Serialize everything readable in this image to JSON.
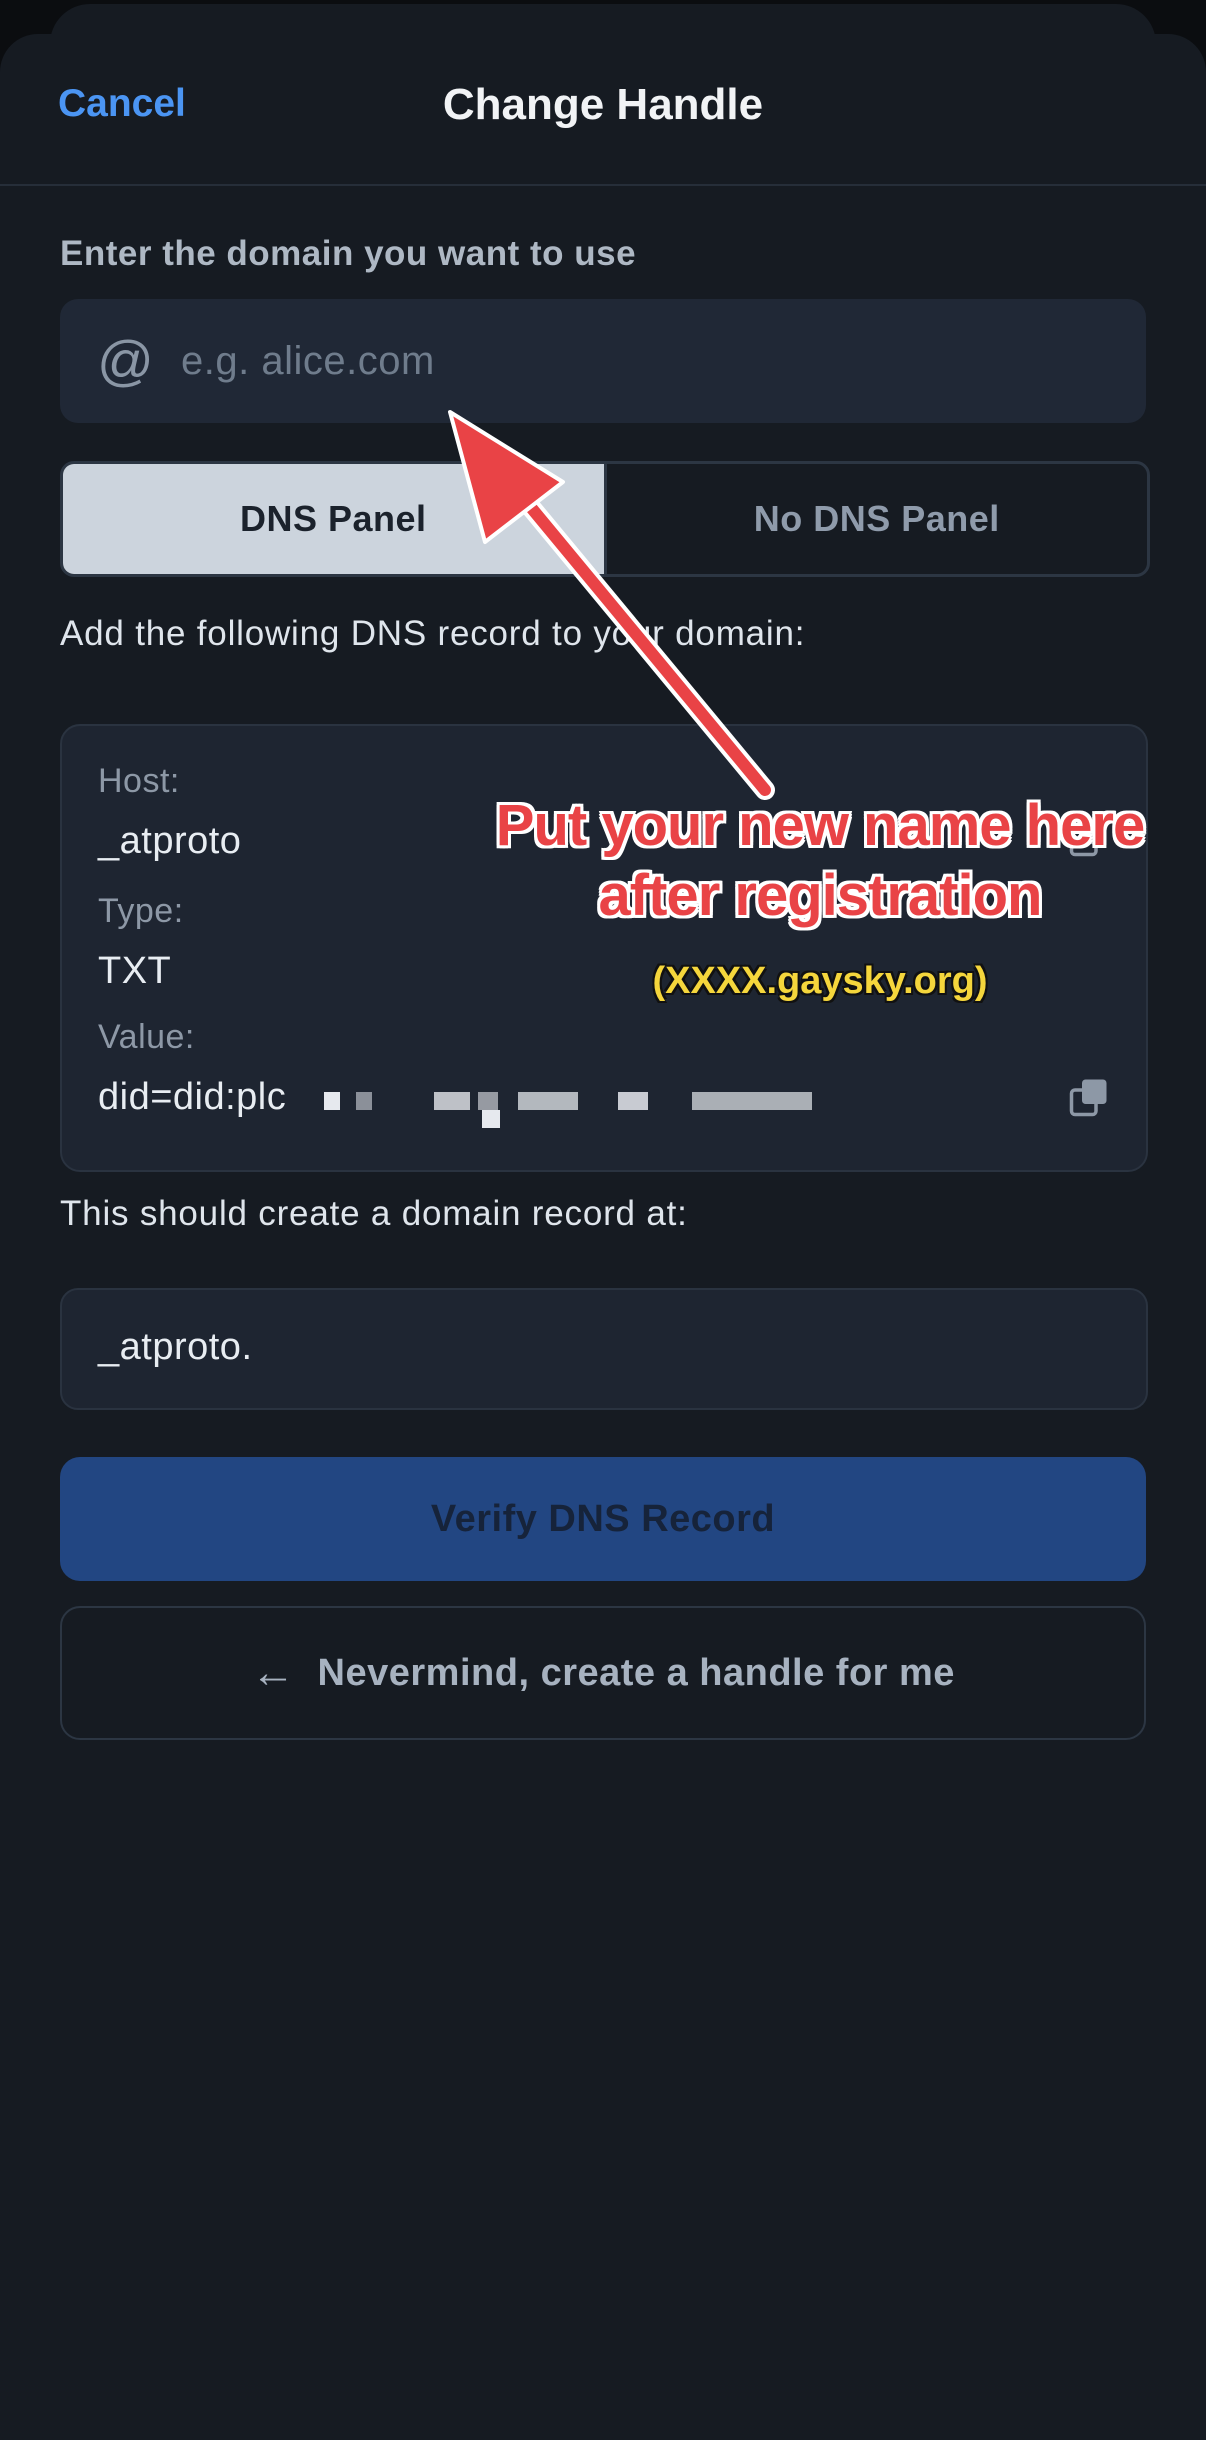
{
  "header": {
    "cancel_label": "Cancel",
    "title": "Change Handle"
  },
  "domain_section": {
    "label": "Enter the domain you want to use",
    "at_symbol": "@",
    "placeholder": "e.g. alice.com",
    "value": ""
  },
  "segmented": {
    "options": [
      "DNS Panel",
      "No DNS Panel"
    ],
    "selected": "DNS Panel"
  },
  "instructions": "Add the following DNS record to your domain:",
  "record": {
    "host_label": "Host:",
    "host_value": "_atproto",
    "type_label": "Type:",
    "type_value": "TXT",
    "value_label": "Value:",
    "value_prefix": "did=did:plc"
  },
  "domain_record": {
    "label": "This should create a domain record at:",
    "value": "_atproto."
  },
  "buttons": {
    "verify": "Verify DNS Record",
    "nevermind": "Nevermind, create a handle for me"
  },
  "annotation": {
    "line1": "Put your new name here",
    "line2": "after registration",
    "sub": "(XXXX.gaysky.org)"
  },
  "colors": {
    "accent": "#4b95f3",
    "annotation": "#e94346",
    "annotation_sub": "#f5d63c"
  }
}
